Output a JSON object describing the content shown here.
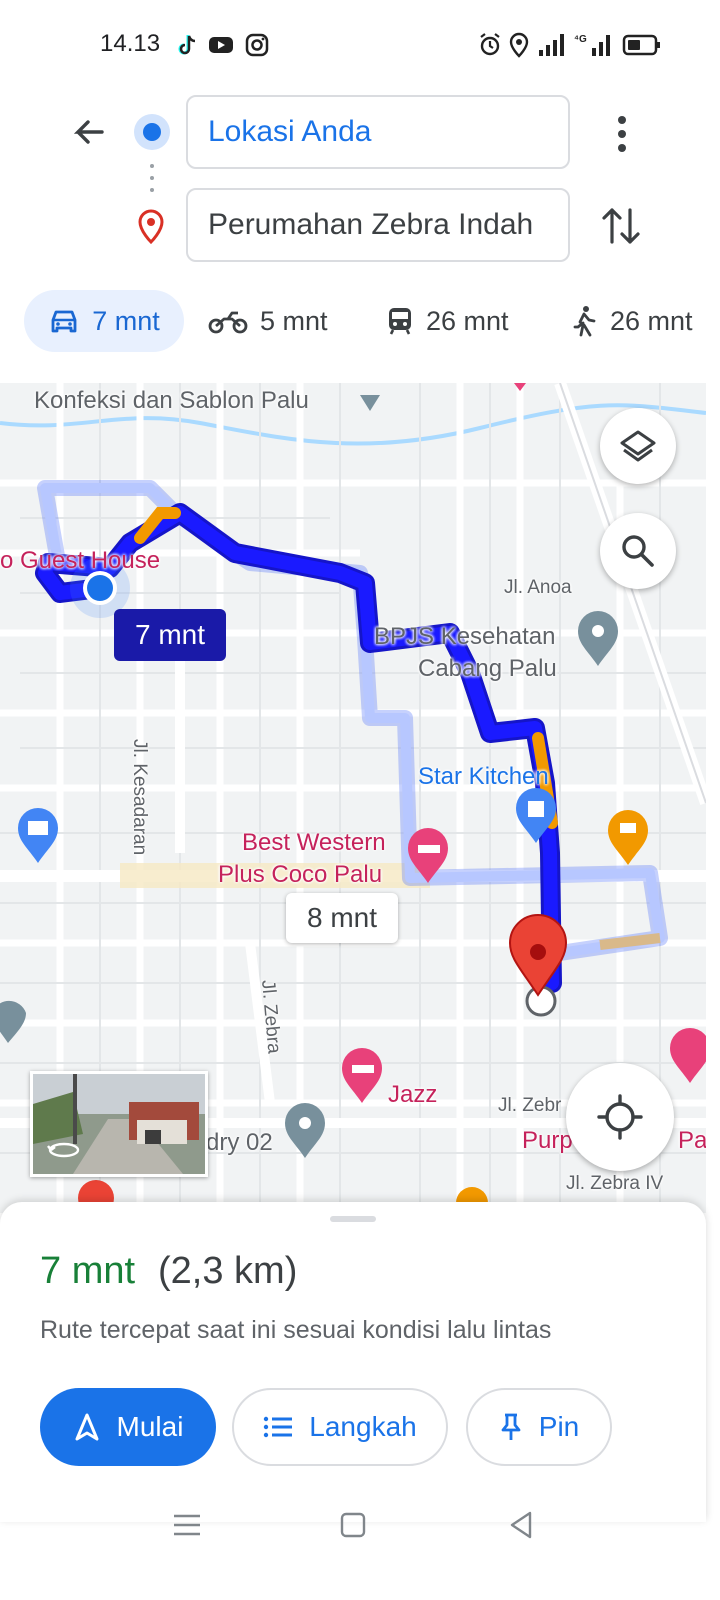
{
  "status_bar": {
    "time": "14.13",
    "left_icons": [
      "tiktok-icon",
      "youtube-icon",
      "instagram-icon"
    ],
    "right_icons": [
      "alarm-icon",
      "location-icon",
      "signal-icon",
      "4g-signal-icon",
      "battery-icon"
    ]
  },
  "directions": {
    "origin": "Lokasi Anda",
    "destination": "Perumahan Zebra Indah"
  },
  "modes": [
    {
      "icon": "car-icon",
      "label": "7 mnt",
      "selected": true
    },
    {
      "icon": "motorcycle-icon",
      "label": "5 mnt"
    },
    {
      "icon": "transit-icon",
      "label": "26 mnt"
    },
    {
      "icon": "walk-icon",
      "label": "26 mnt"
    }
  ],
  "map": {
    "labels": {
      "konfeksi": "Konfeksi dan Sablon Palu",
      "guest_house": "o Guest House",
      "jl_anoa": "Jl. Anoa",
      "bpjs_1": "BPJS Kesehatan",
      "bpjs_2": "Cabang Palu",
      "jl_kesadaran": "Jl. Kesadaran",
      "star_kitchen": "Star Kitchen",
      "best_western_1": "Best Western",
      "best_western_2": "Plus Coco Palu",
      "jl_zebra": "Jl. Zebra",
      "jazz": "Jazz",
      "jl_zebra_2": "Jl. Zebr",
      "laundry": "dry 02",
      "purple": "Purp",
      "purple_end": "Pa",
      "jl_zebra_iv": "Jl. Zebra IV"
    },
    "route_time": "7 mnt",
    "alt_route_time": "8 mnt",
    "colors": {
      "route": "#1a1aff",
      "alt_route": "#a8c0ff",
      "traffic": "#f29900",
      "callout": "#1a1aa8"
    }
  },
  "summary": {
    "time": "7 mnt",
    "distance": "(2,3 km)",
    "note": "Rute tercepat saat ini sesuai kondisi lalu lintas"
  },
  "actions": {
    "start": "Mulai",
    "steps": "Langkah",
    "pin": "Pin"
  },
  "colors": {
    "accent": "#1a73e8",
    "time_green": "#188038"
  }
}
